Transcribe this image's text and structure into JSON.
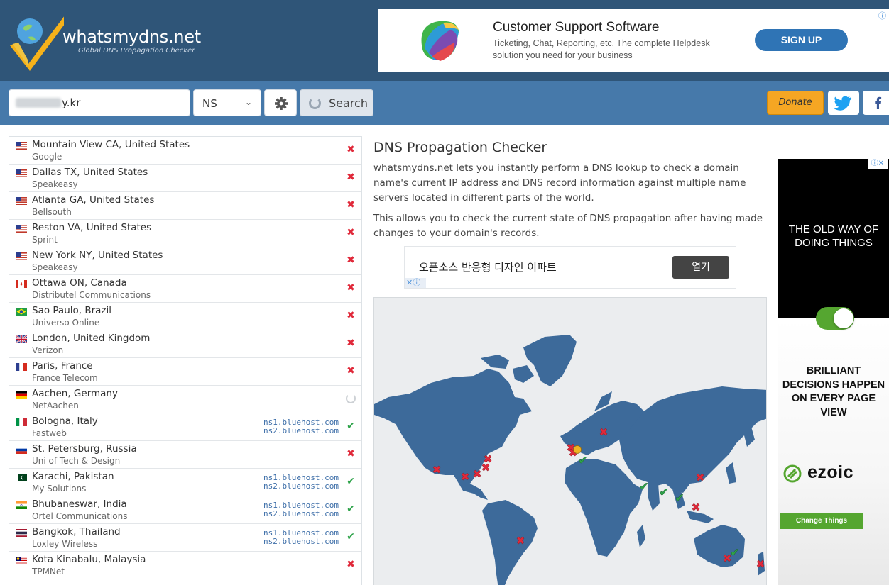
{
  "header": {
    "site_name": "whatsmydns.net",
    "tagline": "Global DNS Propagation Checker"
  },
  "top_ad": {
    "title": "Customer Support Software",
    "text": "Ticketing, Chat, Reporting, etc. The complete Helpdesk solution you need for your business",
    "button": "SIGN UP",
    "info_icon": "info-icon"
  },
  "search": {
    "domain_value": "y.kr",
    "record_type": "NS",
    "search_label": "Search",
    "donate_label": "Donate",
    "icons": [
      "gear-icon",
      "spinner-icon",
      "twitter-icon",
      "facebook-icon"
    ]
  },
  "results": [
    {
      "location": "Mountain View CA, United States",
      "provider": "Google",
      "flag": "us",
      "status": "fail",
      "ns": []
    },
    {
      "location": "Dallas TX, United States",
      "provider": "Speakeasy",
      "flag": "us",
      "status": "fail",
      "ns": []
    },
    {
      "location": "Atlanta GA, United States",
      "provider": "Bellsouth",
      "flag": "us",
      "status": "fail",
      "ns": []
    },
    {
      "location": "Reston VA, United States",
      "provider": "Sprint",
      "flag": "us",
      "status": "fail",
      "ns": []
    },
    {
      "location": "New York NY, United States",
      "provider": "Speakeasy",
      "flag": "us",
      "status": "fail",
      "ns": []
    },
    {
      "location": "Ottawa ON, Canada",
      "provider": "Distributel Communications",
      "flag": "ca",
      "status": "fail",
      "ns": []
    },
    {
      "location": "Sao Paulo, Brazil",
      "provider": "Universo Online",
      "flag": "br",
      "status": "fail",
      "ns": []
    },
    {
      "location": "London, United Kingdom",
      "provider": "Verizon",
      "flag": "gb",
      "status": "fail",
      "ns": []
    },
    {
      "location": "Paris, France",
      "provider": "France Telecom",
      "flag": "fr",
      "status": "fail",
      "ns": []
    },
    {
      "location": "Aachen, Germany",
      "provider": "NetAachen",
      "flag": "de",
      "status": "loading",
      "ns": []
    },
    {
      "location": "Bologna, Italy",
      "provider": "Fastweb",
      "flag": "it",
      "status": "ok",
      "ns": [
        "ns1.bluehost.com",
        "ns2.bluehost.com"
      ]
    },
    {
      "location": "St. Petersburg, Russia",
      "provider": "Uni of Tech & Design",
      "flag": "ru",
      "status": "fail",
      "ns": []
    },
    {
      "location": "Karachi, Pakistan",
      "provider": "My Solutions",
      "flag": "pk",
      "status": "ok",
      "ns": [
        "ns1.bluehost.com",
        "ns2.bluehost.com"
      ]
    },
    {
      "location": "Bhubaneswar, India",
      "provider": "Ortel Communications",
      "flag": "in",
      "status": "ok",
      "ns": [
        "ns1.bluehost.com",
        "ns2.bluehost.com"
      ]
    },
    {
      "location": "Bangkok, Thailand",
      "provider": "Loxley Wireless",
      "flag": "th",
      "status": "ok",
      "ns": [
        "ns1.bluehost.com",
        "ns2.bluehost.com"
      ]
    },
    {
      "location": "Kota Kinabalu, Malaysia",
      "provider": "TPMNet",
      "flag": "my",
      "status": "fail",
      "ns": []
    }
  ],
  "main": {
    "title": "DNS Propagation Checker",
    "para1": "whatsmydns.net lets you instantly perform a DNS lookup to check a domain name's current IP address and DNS record information against multiple name servers located in different parts of the world.",
    "para2": "This allows you to check the current state of DNS propagation after having made changes to your domain's records."
  },
  "mid_ad": {
    "text": "오픈소스 반응형 디자인 이파트",
    "button": "열기"
  },
  "map": {
    "markers": [
      {
        "status": "fail",
        "place": "Mountain View"
      },
      {
        "status": "fail",
        "place": "Dallas"
      },
      {
        "status": "fail",
        "place": "Atlanta"
      },
      {
        "status": "fail",
        "place": "Reston"
      },
      {
        "status": "fail",
        "place": "New York"
      },
      {
        "status": "fail",
        "place": "Ottawa"
      },
      {
        "status": "fail",
        "place": "Sao Paulo"
      },
      {
        "status": "fail",
        "place": "London"
      },
      {
        "status": "fail",
        "place": "Paris"
      },
      {
        "status": "loading",
        "place": "Aachen"
      },
      {
        "status": "ok",
        "place": "Bologna"
      },
      {
        "status": "fail",
        "place": "St. Petersburg"
      },
      {
        "status": "ok",
        "place": "Karachi"
      },
      {
        "status": "ok",
        "place": "Bhubaneswar"
      },
      {
        "status": "ok",
        "place": "Bangkok"
      },
      {
        "status": "fail",
        "place": "Kota Kinabalu"
      },
      {
        "status": "fail",
        "place": "Shanghai"
      },
      {
        "status": "ok",
        "place": "Sydney"
      },
      {
        "status": "fail",
        "place": "Melbourne"
      },
      {
        "status": "fail",
        "place": "Auckland"
      }
    ]
  },
  "side_ad": {
    "dark_text": "THE OLD WAY OF DOING THINGS",
    "headline": "BRILLIANT DECISIONS HAPPEN ON EVERY PAGE VIEW",
    "brand": "ezoic",
    "cta": "Change Things"
  },
  "colors": {
    "header_bg": "#2f5578",
    "searchbar_bg": "#4679aa",
    "map_land": "#3d6a9a",
    "fail": "#e0293a",
    "ok": "#2ea34a",
    "pending": "#f0b323",
    "donate": "#f5a623",
    "ezoic_green": "#55a630"
  }
}
